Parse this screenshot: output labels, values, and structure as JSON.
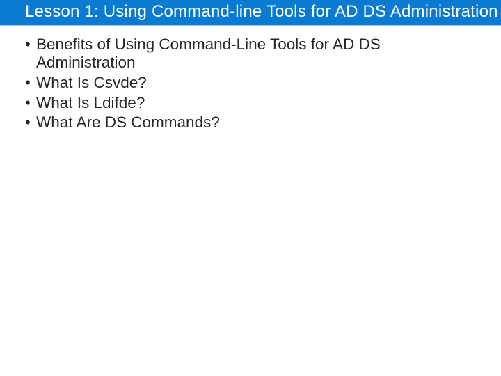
{
  "title": "Lesson 1: Using Command-line Tools for AD DS Administration",
  "bullets": [
    "Benefits of Using Command-Line Tools for AD DS Administration",
    "What Is Csvde?",
    "What Is Ldifde?",
    "What Are DS Commands?"
  ]
}
